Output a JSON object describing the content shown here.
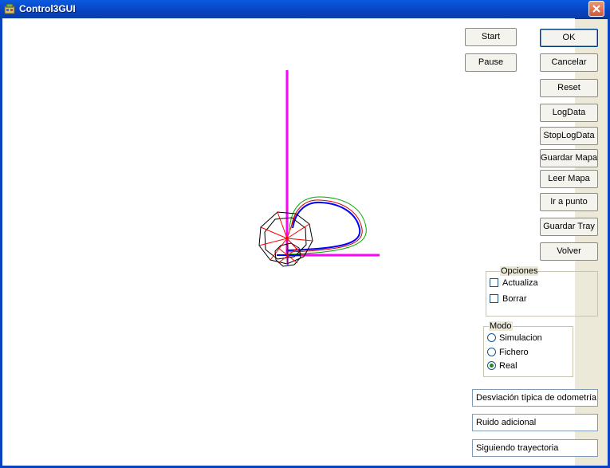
{
  "window": {
    "title": "Control3GUI"
  },
  "buttons": {
    "start": "Start",
    "pause": "Pause",
    "ok": "OK",
    "cancel": "Cancelar",
    "reset": "Reset",
    "log_data": "LogData",
    "stop_log_data": "StopLogData",
    "save_map": "Guardar Mapa",
    "read_map": "Leer Mapa",
    "go_to_point": "Ir a punto",
    "save_trajectory": "Guardar Tray",
    "return": "Volver"
  },
  "options": {
    "label": "Opciones",
    "items": [
      {
        "label": "Actualiza",
        "checked": false
      },
      {
        "label": "Borrar",
        "checked": false
      }
    ]
  },
  "mode": {
    "label": "Modo",
    "items": [
      {
        "label": "Simulacion",
        "selected": false
      },
      {
        "label": "Fichero",
        "selected": false
      },
      {
        "label": "Real",
        "selected": true
      }
    ]
  },
  "status_fields": {
    "odometry": "Desviación típica de odometría",
    "noise": "Ruido adicional",
    "state": "Siguiendo trayectoria"
  },
  "colors": {
    "axis": "#ff00ff",
    "trajectory": "#0000ff",
    "reference": "#00aa00",
    "robot": "#000000",
    "rays": "#ff0000"
  }
}
